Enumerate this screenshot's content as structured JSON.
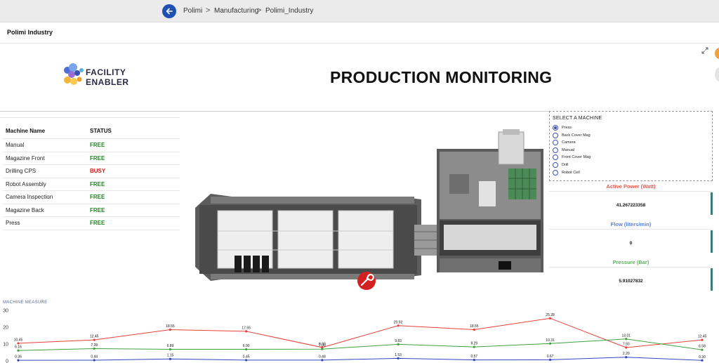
{
  "breadcrumb": {
    "items": [
      "Polimi",
      "Manufacturing",
      "Polimi_Industry"
    ],
    "separator": ">"
  },
  "page": {
    "title": "Polimi Industry"
  },
  "logo": {
    "line1": "FACILITY",
    "line2": "ENABLER"
  },
  "dashboard": {
    "heading": "PRODUCTION MONITORING"
  },
  "status_table": {
    "headers": [
      "Machine Name",
      "STATUS"
    ],
    "rows": [
      {
        "name": "Manual",
        "status": "FREE"
      },
      {
        "name": "Magazine Front",
        "status": "FREE"
      },
      {
        "name": "Drilling CPS",
        "status": "BUSY"
      },
      {
        "name": "Robot Assembly",
        "status": "FREE"
      },
      {
        "name": "Camera Inspection",
        "status": "FREE"
      },
      {
        "name": "Magazine Back",
        "status": "FREE"
      },
      {
        "name": "Press",
        "status": "FREE"
      }
    ],
    "colors": {
      "FREE": "#1f8a1f",
      "BUSY": "#d11a1a"
    }
  },
  "machine_select": {
    "legend": "SELECT A MACHINE",
    "options": [
      "Press",
      "Back Cover Mag",
      "Camera",
      "Manual",
      "Front Cover Mag",
      "Drill",
      "Robot Cell"
    ],
    "selected": "Press"
  },
  "metrics": [
    {
      "title": "Active Power (Watt)",
      "value": "41.267223358",
      "color": "#e05a4f"
    },
    {
      "title": "Flow (liters/min)",
      "value": "0",
      "color": "#5a7fd6"
    },
    {
      "title": "Pressure (Bar)",
      "value": "5.91027832",
      "color": "#5cb35c"
    }
  ],
  "chart_data": {
    "type": "line",
    "title": "MACHINE MEASURE",
    "ylim": [
      0,
      30
    ],
    "yticks": [
      0,
      10,
      20,
      30
    ],
    "grid": false,
    "series": [
      {
        "color": "#e8413a",
        "values": [
          10.45,
          12.45,
          18.55,
          17.55,
          8.0,
          20.92,
          18.55,
          25.28,
          7.93,
          12.45
        ]
      },
      {
        "color": "#3ea33e",
        "values": [
          6.16,
          7.28,
          6.89,
          6.9,
          7.0,
          9.83,
          8.29,
          10.31,
          13.01,
          6.58
        ]
      },
      {
        "color": "#2f45c2",
        "values": [
          0.36,
          0.44,
          1.15,
          0.45,
          0.48,
          1.53,
          0.57,
          0.67,
          2.2,
          0.3
        ]
      }
    ],
    "labels": [
      [
        "10.45",
        "12.45",
        "18.55",
        "17.55",
        "8.00",
        "20.92",
        "18.55",
        "25.28",
        "7.93",
        "12.45"
      ],
      [
        "6.16",
        "7.28",
        "6.89",
        "6.90",
        "7.00",
        "9.83",
        "8.29",
        "10.31",
        "13.01",
        "6.58"
      ],
      [
        "0.36",
        "0.44",
        "1.15",
        "0.45",
        "0.48",
        "1.53",
        "0.57",
        "0.67",
        "2.20",
        "0.30"
      ]
    ]
  }
}
